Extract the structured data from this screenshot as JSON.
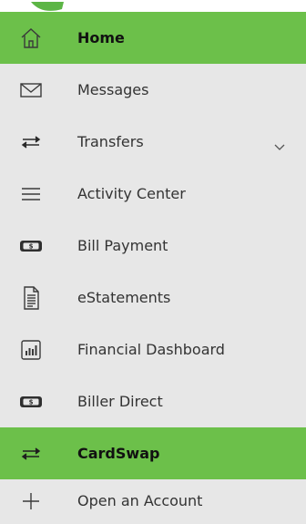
{
  "menu": {
    "items": [
      {
        "label": "Home",
        "icon": "home-icon",
        "active": true
      },
      {
        "label": "Messages",
        "icon": "envelope-icon",
        "active": false
      },
      {
        "label": "Transfers",
        "icon": "transfer-arrows-icon",
        "active": false,
        "expandable": true
      },
      {
        "label": "Activity Center",
        "icon": "hamburger-list-icon",
        "active": false
      },
      {
        "label": "Bill Payment",
        "icon": "dollar-bill-icon",
        "active": false
      },
      {
        "label": "eStatements",
        "icon": "document-icon",
        "active": false
      },
      {
        "label": "Financial Dashboard",
        "icon": "bar-chart-icon",
        "active": false
      },
      {
        "label": "Biller Direct",
        "icon": "dollar-bill-icon",
        "active": false
      },
      {
        "label": "CardSwap",
        "icon": "transfer-arrows-icon",
        "active": true
      },
      {
        "label": "Open an Account",
        "icon": "plus-icon",
        "active": false
      }
    ]
  },
  "colors": {
    "active": "#6cc04a",
    "background": "#e7e7e7",
    "text": "#333333"
  }
}
